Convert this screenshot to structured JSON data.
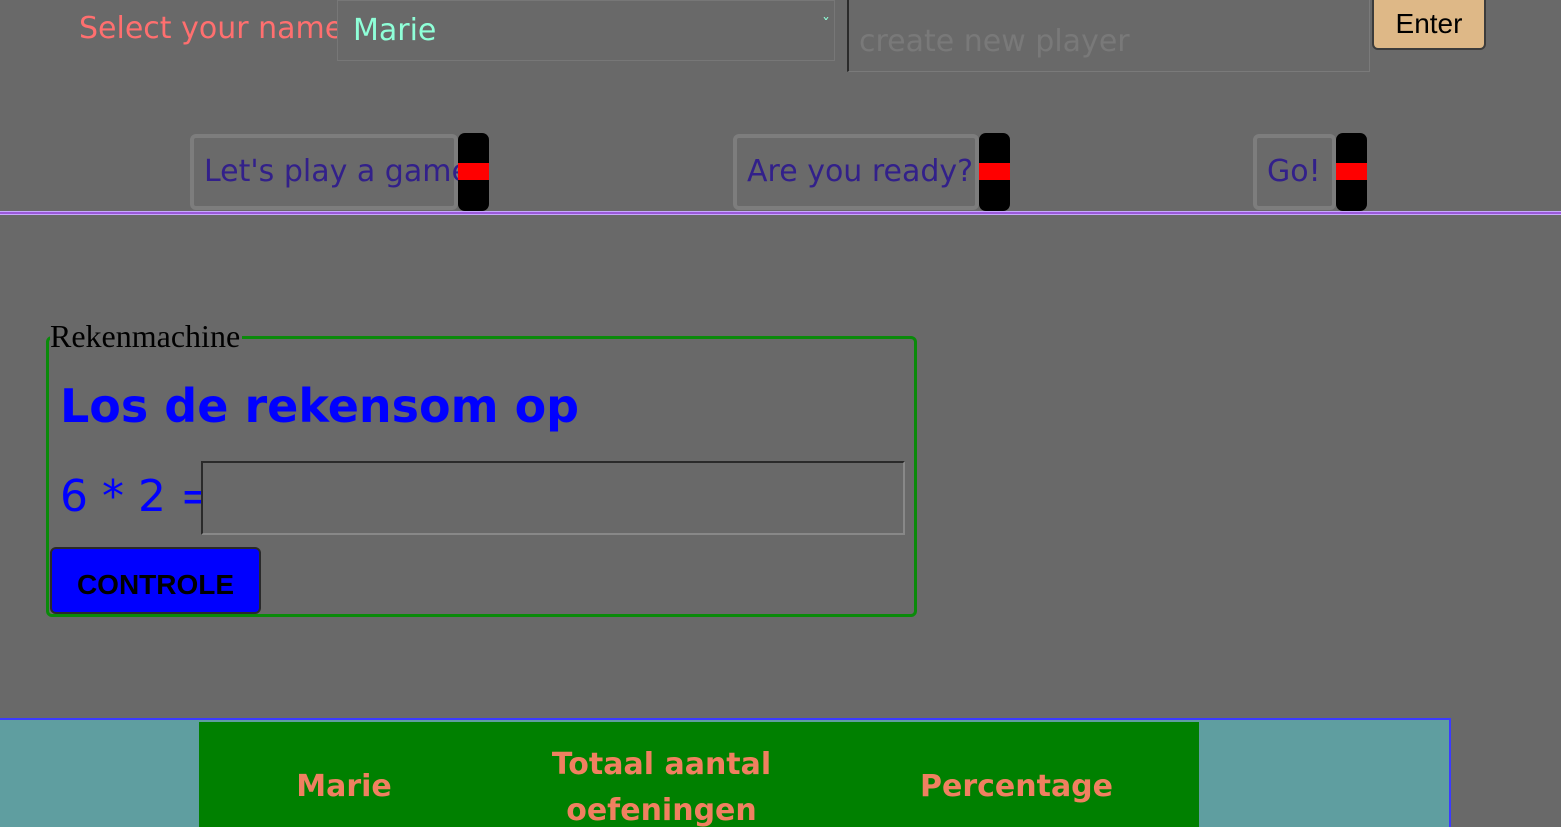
{
  "player": {
    "label": "Select your name",
    "selected": "Marie",
    "new_player_placeholder": "create new player",
    "enter_label": "Enter"
  },
  "modes": [
    {
      "label": "Let's play a game",
      "enabled": false
    },
    {
      "label": "Are you ready?",
      "enabled": false
    },
    {
      "label": "Go!",
      "enabled": false
    }
  ],
  "calculator": {
    "legend": "Rekenmachine",
    "title": "Los de rekensom op",
    "question": "6 * 2 =",
    "answer": "",
    "check_label": "CONTROLE"
  },
  "results": {
    "headers": [
      "Marie",
      "Totaal aantal oefeningen",
      "Percentage"
    ]
  },
  "colors": {
    "background": "#696969",
    "accent_blue": "#0000ff",
    "label_red": "#ff6f6f",
    "select_text": "#8fffd8",
    "enter_button": "#deb887",
    "switch_knob": "#ff0000",
    "table_green": "#008000",
    "table_area": "#5f9ea0"
  },
  "icons": {
    "select_chevron": "chevron-down-icon"
  }
}
